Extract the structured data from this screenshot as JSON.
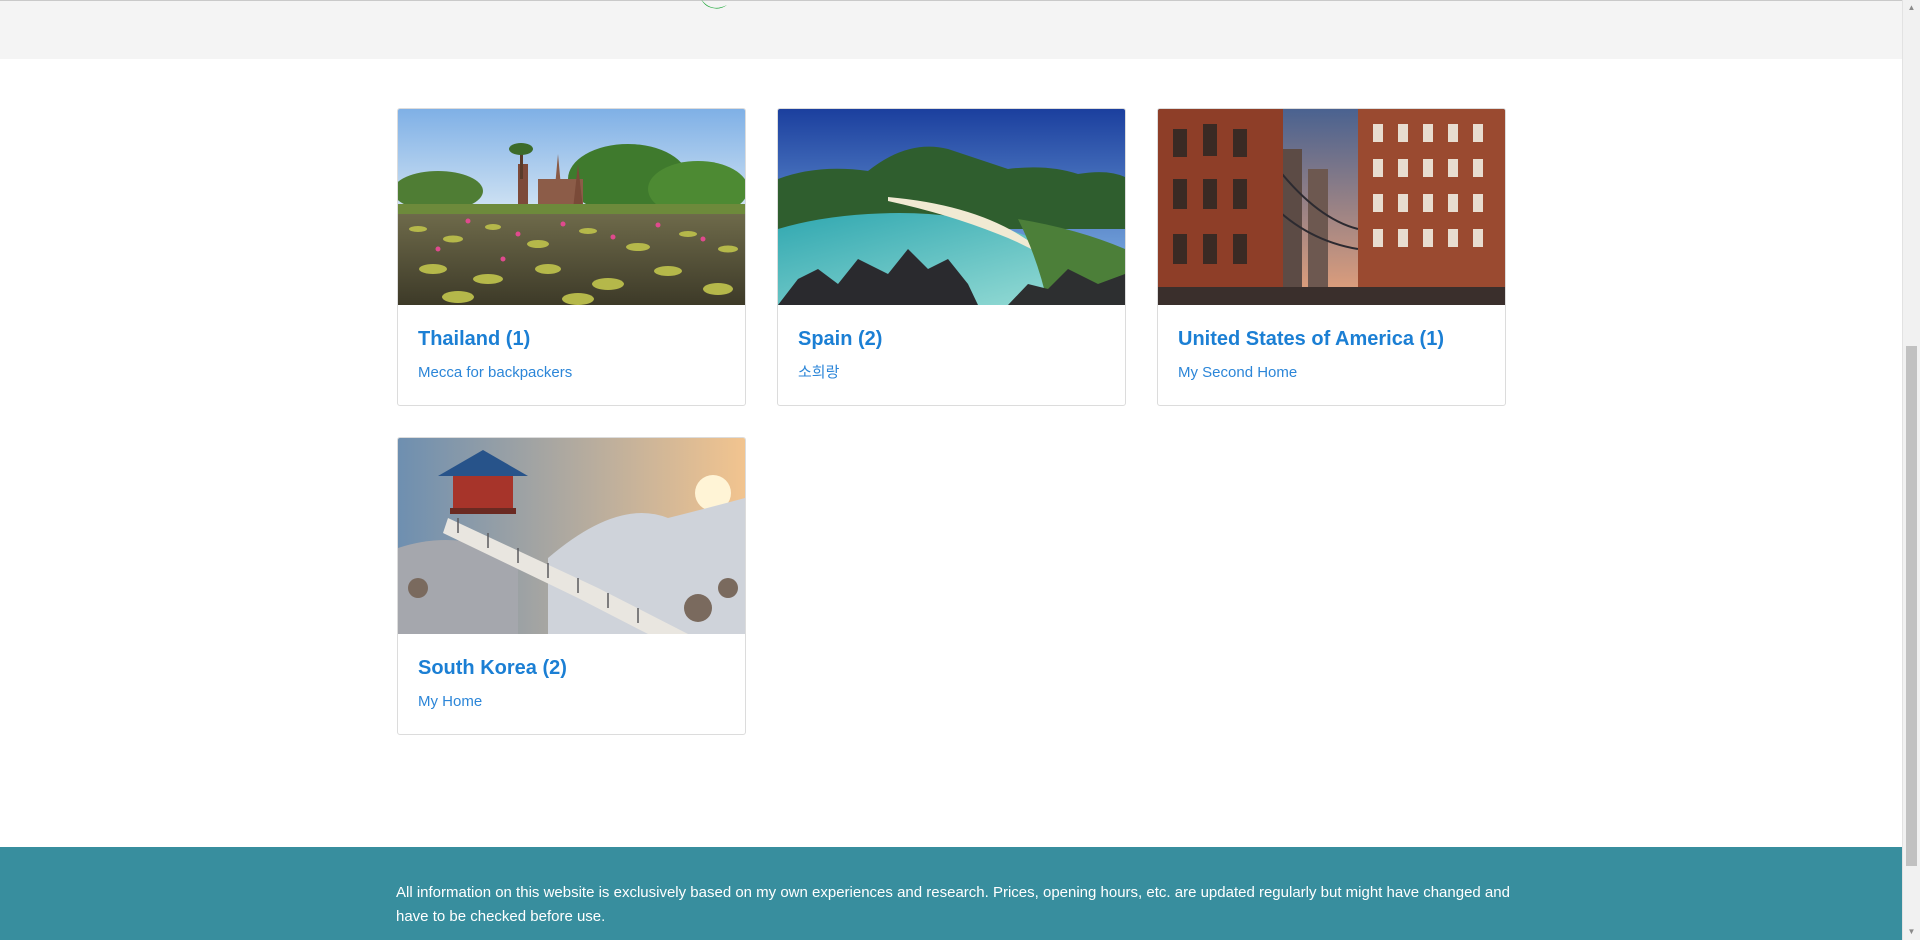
{
  "header": {
    "logo_icon": "leaf-logo-icon"
  },
  "destinations": [
    {
      "title": "Thailand (1)",
      "subtitle": "Mecca for backpackers",
      "image": "thailand-temple-lotus-pond-image"
    },
    {
      "title": "Spain (2)",
      "subtitle": "소희랑",
      "image": "tropical-beach-bay-image"
    },
    {
      "title": "United States of America (1)",
      "subtitle": "My Second Home",
      "image": "brooklyn-manhattan-bridge-image"
    },
    {
      "title": "South Korea (2)",
      "subtitle": "My Home",
      "image": "snowy-pavilion-bridge-image"
    }
  ],
  "footer": {
    "text": "All information on this website is exclusively based on my own experiences and research. Prices, opening hours, etc. are updated regularly but might have changed and have to be checked before use."
  },
  "colors": {
    "link": "#1b7fd4",
    "footer_bg": "#388e9e",
    "header_bg": "#f4f4f4"
  }
}
